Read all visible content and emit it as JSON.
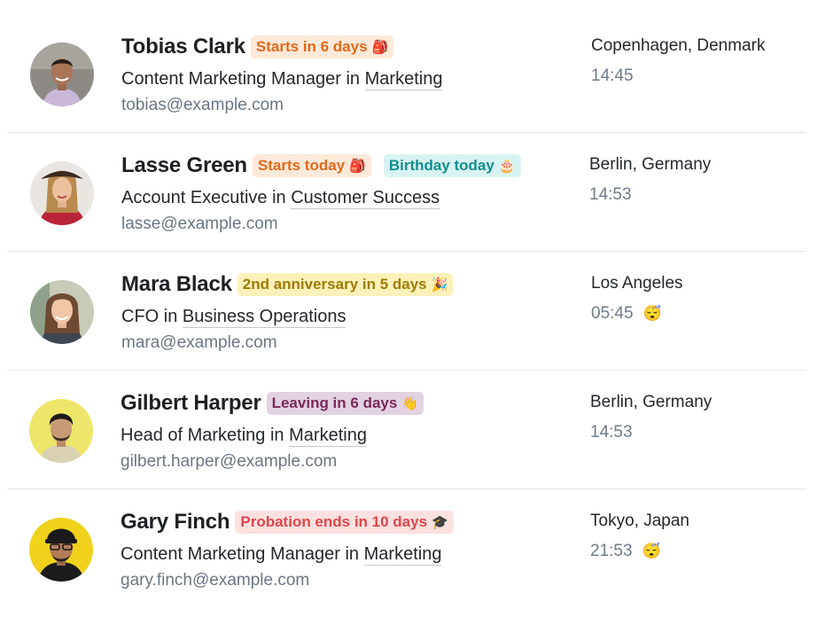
{
  "people": [
    {
      "name": "Tobias Clark",
      "badges": [
        {
          "text": "Starts in 6 days",
          "emoji": "🎒",
          "color": "orange"
        }
      ],
      "title": "Content Marketing Manager",
      "connector": "in",
      "department": "Marketing",
      "email": "tobias@example.com",
      "location": "Copenhagen, Denmark",
      "time": "14:45",
      "time_emoji": ""
    },
    {
      "name": "Lasse Green",
      "badges": [
        {
          "text": "Starts today",
          "emoji": "🎒",
          "color": "orange"
        },
        {
          "text": "Birthday today",
          "emoji": "🎂",
          "color": "teal"
        }
      ],
      "title": "Account Executive",
      "connector": "in",
      "department": "Customer Success",
      "email": "lasse@example.com",
      "location": "Berlin, Germany",
      "time": "14:53",
      "time_emoji": ""
    },
    {
      "name": "Mara Black",
      "badges": [
        {
          "text": "2nd anniversary in 5 days",
          "emoji": "🎉",
          "color": "yellow"
        }
      ],
      "title": "CFO",
      "connector": "in",
      "department": "Business Operations",
      "email": "mara@example.com",
      "location": "Los Angeles",
      "time": "05:45",
      "time_emoji": "😴"
    },
    {
      "name": "Gilbert Harper",
      "badges": [
        {
          "text": "Leaving in 6 days",
          "emoji": "👋",
          "color": "purple"
        }
      ],
      "title": "Head of Marketing",
      "connector": "in",
      "department": "Marketing",
      "email": "gilbert.harper@example.com",
      "location": "Berlin, Germany",
      "time": "14:53",
      "time_emoji": ""
    },
    {
      "name": "Gary Finch",
      "badges": [
        {
          "text": "Probation ends in 10 days",
          "emoji": "🎓",
          "color": "red"
        }
      ],
      "title": "Content Marketing Manager",
      "connector": "in",
      "department": "Marketing",
      "email": "gary.finch@example.com",
      "location": "Tokyo, Japan",
      "time": "21:53",
      "time_emoji": "😴"
    }
  ]
}
